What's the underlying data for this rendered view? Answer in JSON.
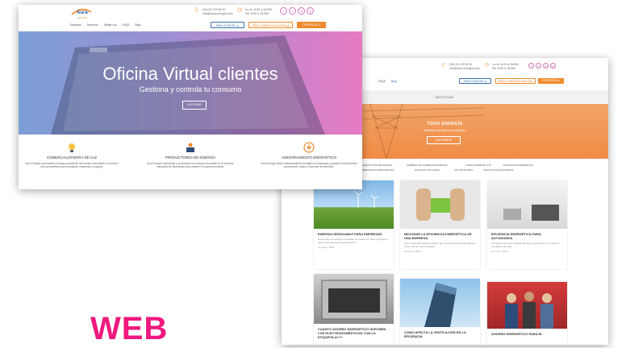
{
  "label": {
    "text": "WEB",
    "color": "#f0197d"
  },
  "front": {
    "logo": {
      "name": "Aura",
      "sub": "Energía"
    },
    "phone": {
      "line1": "(34) 93 178 06 90",
      "line2": "info@aura-energia.com"
    },
    "hours": {
      "line1": "Lu-Ju: 8:00 a 18:00h",
      "line2": "Vie: 8:00 a 15:00h"
    },
    "social": [
      "f",
      "t",
      "in",
      "g"
    ],
    "nav": [
      "Empresa",
      "Servicios",
      "Tarifas Luz",
      "FAQS",
      "Blog"
    ],
    "buttons": {
      "area_clientes": "ÁREA CLIENTES ▲",
      "area_comercializadora": "ÁREA COMERCIALIZADORA ◉",
      "contratar": "CONTRATAR ➜"
    },
    "hero": {
      "title": "Oficina Virtual clientes",
      "subtitle": "Gestiona y controla tu consumo",
      "button": "ACCEDER",
      "slider_dots": 3,
      "active_dot": 1
    },
    "features": [
      {
        "title": "COMERCIALIZADORA DE LUZ",
        "text": "Aura Energía comercializa energía procedente de fuentes renovables con precios muy competitivos para industrias, empresas y hogares."
      },
      {
        "title": "PRODUCTORES DE ENERGÍA",
        "text": "Aura Energía representa a productores de energía renovable en el mercado mayorista de electricidad para obtener el máximo beneficio."
      },
      {
        "title": "ASESORAMIENTO ENERGÉTICO",
        "text": "Aura Energía ofrece asesoramiento energético a empresas y grandes corporaciones para reducir costes y fomentar la eficiencia."
      }
    ],
    "colors": {
      "hero_left": "#7b9ed6",
      "hero_right": "#e77ac4",
      "accent": "#f08a2c",
      "brand": "#1f4f8f"
    }
  },
  "back": {
    "phone": {
      "line1": "(34) 93 178 06 90",
      "line2": "info@aura-energia.com"
    },
    "hours": {
      "line1": "Lu-Ju: 8:00 a 18:00h",
      "line2": "Vie: 8:00 a 15:00h"
    },
    "social": [
      "f",
      "t",
      "in",
      "g"
    ],
    "nav": [
      "FAQS",
      "Blog"
    ],
    "buttons": {
      "area_clientes": "ÁREA CLIENTES ▲",
      "area_comercializadora": "ÁREA COMERCIALIZADORA ◉",
      "contratar": "CONTRATAR ➜"
    },
    "section_title": "NOTICIAS",
    "hero": {
      "title": "TODO ENERGÍA",
      "subtitle": "Noticias del sector energético",
      "button": "SUSCRÍBETE"
    },
    "categories_row1": [
      "ADAPTACIÓN NECESARIA",
      "CAMBIAR DE COMERCIALIZADORA",
      "CÓMO AHORRAR LUZ",
      "EFICIENCIA ENERGÉTICA"
    ],
    "categories_row2": [
      "PREGUNTAS FRECUENTES",
      "NOTICIAS ACTUALES",
      "SIN CATEGORÍA",
      "VEHÍCULOS ELÉCTRICOS"
    ],
    "cards": [
      {
        "title": "ENERGÍA RENOVABLE PARA EMPRESAS",
        "text": "Las fuentes de energía renovable son cada vez más importantes para empresas que buscan ahorrar.",
        "date": "19 enero, 2018",
        "img": "wind"
      },
      {
        "title": "MEJORAR LA EFICIENCIA ENERGÉTICA DE UNA EMPRESA",
        "text": "Hoy en día, las empresas tienen que tener la eficiencia energética como una de sus prioridades.",
        "date": "19 enero, 2018",
        "img": "plug"
      },
      {
        "title": "EFICIENCIA ENERGÉTICA PARA AUTÓNOMOS",
        "text": "Los autónomos que trabajan desde su casa tienen un consumo energético elevado.",
        "date": "19 enero, 2018",
        "img": "desk"
      },
      {
        "title": "CUANTO AHORRO ENERGÉTICO SUPONEN LOS ELECTRODOMÉSTICOS CON LA ETIQUETA A+++",
        "text": "",
        "date": "",
        "img": "oven"
      },
      {
        "title": "CÓMO AFECTA LA VENTILACIÓN EN LA EFICIENCIA",
        "text": "",
        "date": "",
        "img": "building"
      },
      {
        "title": "AHORRO ENERGÉTICO PARA EL",
        "text": "",
        "date": "",
        "img": "people"
      }
    ],
    "colors": {
      "hero": "#f39a55",
      "accent": "#f08a2c"
    }
  }
}
